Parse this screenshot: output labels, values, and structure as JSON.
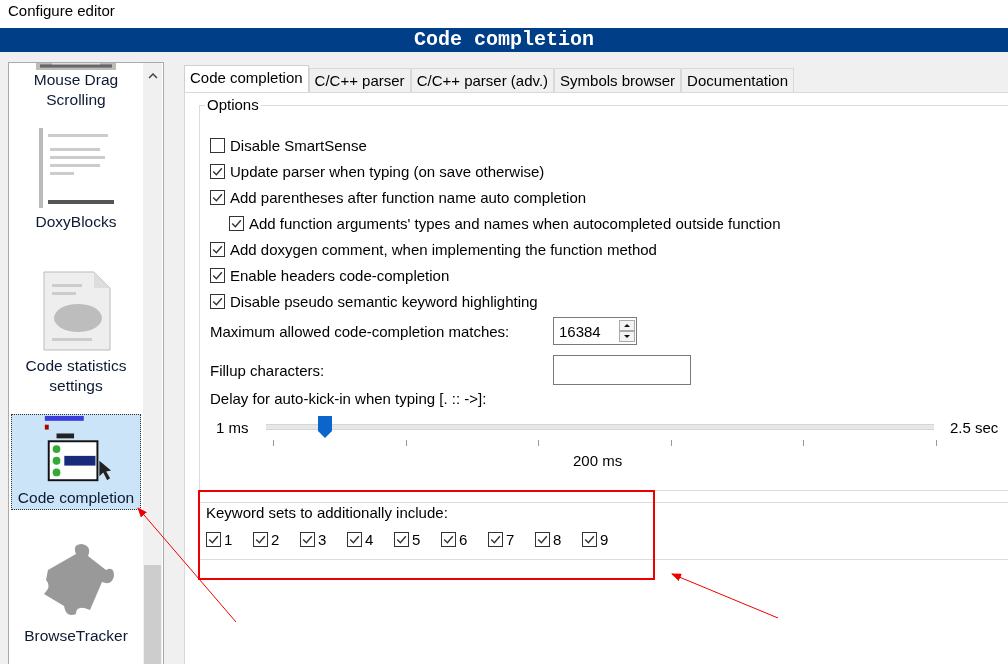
{
  "window": {
    "title": "Configure editor"
  },
  "header": {
    "title": "Code completion"
  },
  "sidebar": {
    "items": [
      {
        "label": "Mouse Drag Scrolling",
        "kind": "strip",
        "selected": false
      },
      {
        "label": "DoxyBlocks",
        "kind": "doc",
        "selected": false
      },
      {
        "label": "Code statistics settings",
        "kind": "page",
        "selected": false
      },
      {
        "label": "Code completion",
        "kind": "popup",
        "selected": true
      },
      {
        "label": "BrowseTracker",
        "kind": "puzzle",
        "selected": false
      }
    ]
  },
  "tabs": [
    {
      "label": "Code completion",
      "selected": true
    },
    {
      "label": "C/C++ parser",
      "selected": false
    },
    {
      "label": "C/C++ parser (adv.)",
      "selected": false
    },
    {
      "label": "Symbols browser",
      "selected": false
    },
    {
      "label": "Documentation",
      "selected": false
    }
  ],
  "options": {
    "title": "Options",
    "checkboxes": [
      {
        "label": "Disable SmartSense",
        "checked": false
      },
      {
        "label": "Update parser when typing (on save otherwise)",
        "checked": true
      },
      {
        "label": "Add parentheses after function name auto completion",
        "checked": true,
        "children": [
          {
            "label": "Add function arguments' types and names when autocompleted outside function",
            "checked": true
          }
        ]
      },
      {
        "label": "Add doxygen comment, when implementing the function method",
        "checked": true
      },
      {
        "label": "Enable headers code-completion",
        "checked": true
      },
      {
        "label": "Disable pseudo semantic keyword highlighting",
        "checked": true
      }
    ],
    "max_matches": {
      "label": "Maximum allowed code-completion matches:",
      "value": "16384"
    },
    "fillup": {
      "label": "Fillup characters:"
    },
    "delay": {
      "label": "Delay for auto-kick-in when typing [. :: ->]:",
      "min_label": "1 ms",
      "max_label": "2.5 sec",
      "value_label": "200 ms",
      "level": 0.088
    }
  },
  "keywords": {
    "title": "Keyword sets to additionally include:",
    "sets": [
      {
        "label": "1",
        "checked": true
      },
      {
        "label": "2",
        "checked": true
      },
      {
        "label": "3",
        "checked": true
      },
      {
        "label": "4",
        "checked": true
      },
      {
        "label": "5",
        "checked": true
      },
      {
        "label": "6",
        "checked": true
      },
      {
        "label": "7",
        "checked": true
      },
      {
        "label": "8",
        "checked": true
      },
      {
        "label": "9",
        "checked": true
      }
    ]
  }
}
